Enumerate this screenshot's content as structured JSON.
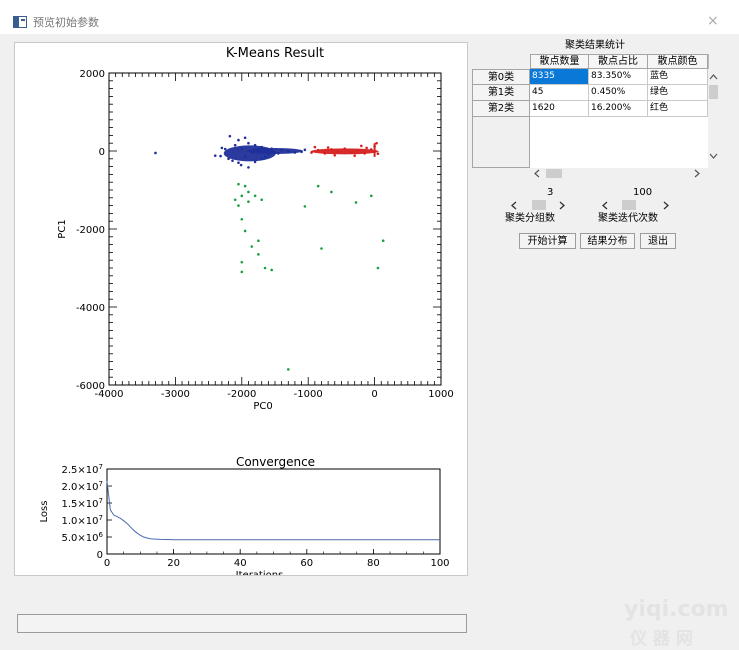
{
  "window": {
    "title": "预览初始参数",
    "icon": "app-window-icon",
    "close_glyph": "×"
  },
  "scatter_chart": {
    "chart_data": {
      "type": "scatter",
      "title": "K-Means Result",
      "xlabel": "PC0",
      "ylabel": "PC1",
      "xlim": [
        -4000,
        1000
      ],
      "ylim": [
        -6000,
        2000
      ],
      "xticks": [
        -4000,
        -3000,
        -2000,
        -1000,
        0,
        1000
      ],
      "yticks": [
        2000,
        0,
        -2000,
        -4000,
        -6000
      ],
      "xtick_labels": [
        "-4000",
        "-3000",
        "-2000",
        "-1000",
        "0",
        "1000"
      ],
      "ytick_labels": [
        "2000",
        "0",
        "-2000",
        "-4000",
        "-6000"
      ],
      "grid": false,
      "colors": {
        "cluster0": "#1f2f9a",
        "cluster1": "#1aa040",
        "cluster2": "#d52020"
      },
      "series": [
        {
          "cluster": 0,
          "color": "#1f2f9a",
          "count": 8335,
          "points": [
            [
              -2180,
              380
            ],
            [
              -2050,
              280
            ],
            [
              -1950,
              340
            ],
            [
              -2100,
              150
            ],
            [
              -1900,
              200
            ],
            [
              -2000,
              60
            ],
            [
              -2250,
              50
            ],
            [
              -2320,
              -130
            ],
            [
              -2140,
              -250
            ],
            [
              -2010,
              -360
            ],
            [
              -1900,
              -420
            ],
            [
              -1800,
              -280
            ],
            [
              -1700,
              -200
            ],
            [
              -1600,
              -100
            ],
            [
              -1500,
              -30
            ],
            [
              -1400,
              30
            ],
            [
              -1300,
              0
            ],
            [
              -1200,
              -40
            ],
            [
              -1100,
              -20
            ],
            [
              -1050,
              30
            ],
            [
              -1800,
              150
            ],
            [
              -1700,
              100
            ],
            [
              -2200,
              -200
            ],
            [
              -3300,
              -50
            ],
            [
              -2400,
              -120
            ],
            [
              -2300,
              80
            ],
            [
              -1950,
              -150
            ],
            [
              -2050,
              -300
            ],
            [
              -1850,
              -40
            ],
            [
              -1750,
              50
            ],
            [
              -1650,
              -150
            ],
            [
              -1550,
              60
            ],
            [
              -1450,
              -60
            ]
          ]
        },
        {
          "cluster": 1,
          "color": "#1aa040",
          "count": 45,
          "points": [
            [
              -2050,
              -850
            ],
            [
              -1950,
              -900
            ],
            [
              -2000,
              -1150
            ],
            [
              -1900,
              -1300
            ],
            [
              -2050,
              -1400
            ],
            [
              -1800,
              -1150
            ],
            [
              -1700,
              -1250
            ],
            [
              -2000,
              -1750
            ],
            [
              -1950,
              -2050
            ],
            [
              -1850,
              -2450
            ],
            [
              -1750,
              -2650
            ],
            [
              -2000,
              -2850
            ],
            [
              -2000,
              -3100
            ],
            [
              -1650,
              -3000
            ],
            [
              -1550,
              -3050
            ],
            [
              -1750,
              -2300
            ],
            [
              -850,
              -900
            ],
            [
              -650,
              -1050
            ],
            [
              -1050,
              -1420
            ],
            [
              -280,
              -1320
            ],
            [
              -50,
              -1150
            ],
            [
              -800,
              -2500
            ],
            [
              130,
              -2300
            ],
            [
              50,
              -3000
            ],
            [
              -1300,
              -5600
            ],
            [
              -2100,
              -1250
            ],
            [
              -1900,
              -1050
            ]
          ]
        },
        {
          "cluster": 2,
          "color": "#d52020",
          "count": 1620,
          "points": [
            [
              -950,
              -40
            ],
            [
              -850,
              20
            ],
            [
              -750,
              -60
            ],
            [
              -650,
              40
            ],
            [
              -550,
              -20
            ],
            [
              -450,
              60
            ],
            [
              -350,
              -40
            ],
            [
              -250,
              20
            ],
            [
              -150,
              -60
            ],
            [
              -50,
              40
            ],
            [
              0,
              120
            ],
            [
              50,
              -70
            ],
            [
              30,
              200
            ],
            [
              -120,
              80
            ],
            [
              -300,
              -120
            ],
            [
              -600,
              -110
            ],
            [
              -900,
              100
            ],
            [
              -200,
              130
            ],
            [
              -700,
              90
            ]
          ]
        }
      ]
    }
  },
  "loss_chart": {
    "chart_data": {
      "type": "line",
      "title": "Convergence",
      "xlabel": "Iterations",
      "ylabel": "Loss",
      "xlim": [
        0,
        100
      ],
      "ylim": [
        0,
        25000000
      ],
      "xticks": [
        0,
        20,
        40,
        60,
        80,
        100
      ],
      "yticks": [
        0,
        5000000,
        10000000,
        15000000,
        20000000,
        25000000
      ],
      "xtick_labels": [
        "0",
        "20",
        "40",
        "60",
        "80",
        "100"
      ],
      "ytick_base": [
        "0",
        "5.0×10",
        "1.0×10",
        "1.5×10",
        "2.0×10",
        "2.5×10"
      ],
      "ytick_exp": [
        "",
        "6",
        "7",
        "7",
        "7",
        "7"
      ],
      "grid": false,
      "color": "#4a6bb0",
      "x": [
        0,
        1,
        2,
        3,
        4,
        5,
        6,
        7,
        8,
        9,
        10,
        11,
        12,
        13,
        14,
        16,
        18,
        20,
        25,
        30,
        40,
        60,
        80,
        100
      ],
      "y": [
        21500000,
        13000000,
        11500000,
        11000000,
        10500000,
        9800000,
        9000000,
        8000000,
        7000000,
        6200000,
        5500000,
        5000000,
        4700000,
        4500000,
        4400000,
        4300000,
        4250000,
        4200000,
        4200000,
        4200000,
        4200000,
        4200000,
        4200000,
        4200000
      ]
    }
  },
  "stats_table": {
    "title": "聚类结果统计",
    "columns": [
      "散点数量",
      "散点占比",
      "散点颜色"
    ],
    "rows": [
      {
        "label": "第0类",
        "count": "8335",
        "ratio": "83.350%",
        "color": "蓝色"
      },
      {
        "label": "第1类",
        "count": "45",
        "ratio": "0.450%",
        "color": "绿色"
      },
      {
        "label": "第2类",
        "count": "1620",
        "ratio": "16.200%",
        "color": "红色"
      }
    ]
  },
  "controls": {
    "clusters": {
      "value": "3",
      "label": "聚类分组数"
    },
    "iterations": {
      "value": "100",
      "label": "聚类迭代次数"
    },
    "buttons": {
      "start": "开始计算",
      "distribution": "结果分布",
      "exit": "退出"
    }
  },
  "watermark": {
    "line1": "yiqi.com",
    "line2": "仪 器 网"
  }
}
